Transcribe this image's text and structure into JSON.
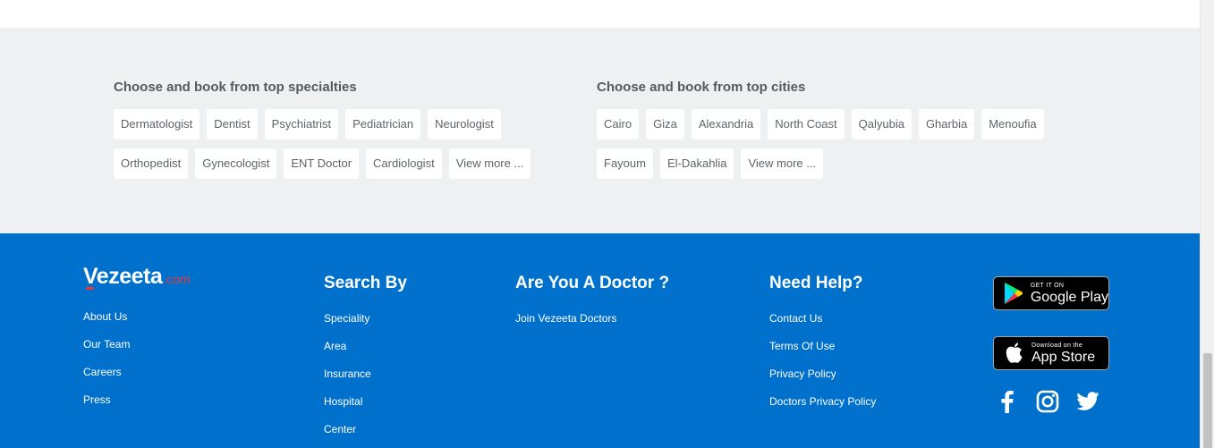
{
  "specialties": {
    "title": "Choose and book from top specialties",
    "row1": [
      "Dermatologist",
      "Dentist",
      "Psychiatrist",
      "Pediatrician",
      "Neurologist"
    ],
    "row2": [
      "Orthopedist",
      "Gynecologist",
      "ENT Doctor",
      "Cardiologist",
      "View more ..."
    ]
  },
  "cities": {
    "title": "Choose and book from top cities",
    "row1": [
      "Cairo",
      "Giza",
      "Alexandria",
      "North Coast",
      "Qalyubia",
      "Gharbia",
      "Menoufia"
    ],
    "row2": [
      "Fayoum",
      "El-Dakahlia",
      "View more ..."
    ]
  },
  "footer": {
    "logo": {
      "main": "Vezeeta",
      "ext": ".com"
    },
    "about_links": [
      "About Us",
      "Our Team",
      "Careers",
      "Press"
    ],
    "search_by": {
      "title": "Search By",
      "links": [
        "Speciality",
        "Area",
        "Insurance",
        "Hospital",
        "Center"
      ]
    },
    "doctor": {
      "title": "Are You A Doctor ?",
      "links": [
        "Join Vezeeta Doctors"
      ]
    },
    "help": {
      "title": "Need Help?",
      "links": [
        "Contact Us",
        "Terms Of Use",
        "Privacy Policy",
        "Doctors Privacy Policy"
      ]
    },
    "google_play": {
      "small": "GET IT ON",
      "big": "Google Play"
    },
    "app_store": {
      "small": "Download on the",
      "big": "App Store"
    },
    "social_icons": [
      "facebook-icon",
      "instagram-icon",
      "twitter-icon"
    ]
  },
  "colors": {
    "band_bg": "#eff0f2",
    "footer_bg": "#0070cd",
    "logo_accent": "#e8363a"
  }
}
